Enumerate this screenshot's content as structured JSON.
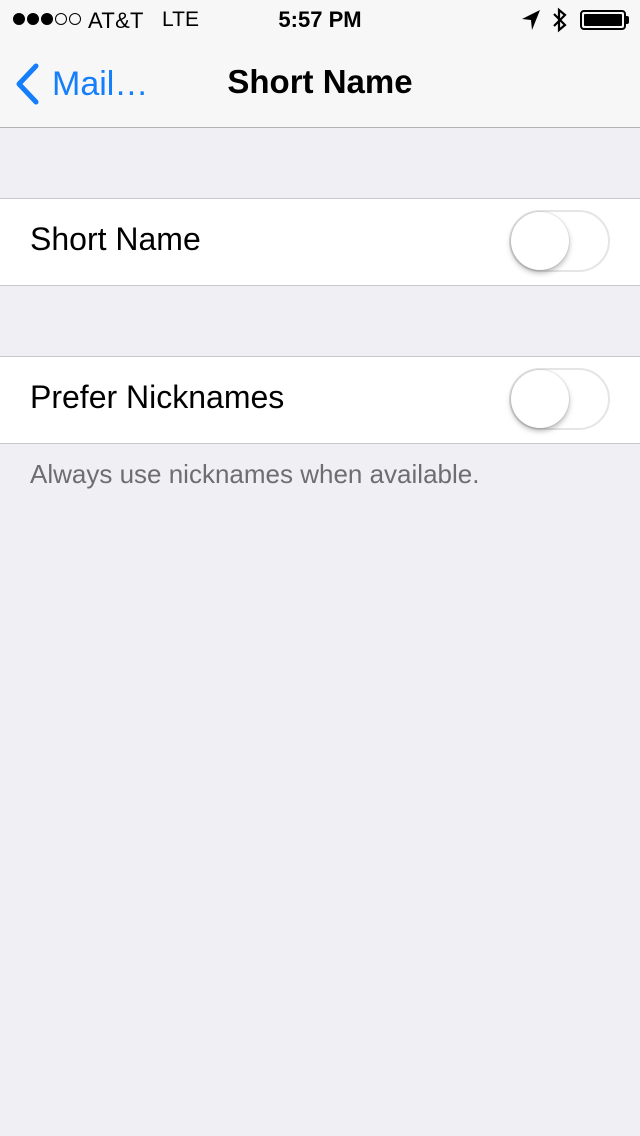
{
  "status_bar": {
    "signal_bars_filled": 3,
    "signal_bars_total": 5,
    "carrier": "AT&T",
    "network": "LTE",
    "time": "5:57 PM",
    "icons": [
      "location-arrow-icon",
      "bluetooth-icon",
      "battery-icon"
    ],
    "battery_level": 1.0
  },
  "nav": {
    "back_label": "Mail…",
    "title": "Short Name",
    "accent_color": "#147efb"
  },
  "settings": {
    "short_name": {
      "label": "Short Name",
      "enabled": false
    },
    "prefer_nicknames": {
      "label": "Prefer Nicknames",
      "enabled": false
    },
    "prefer_nicknames_footer": "Always use nicknames when available."
  }
}
